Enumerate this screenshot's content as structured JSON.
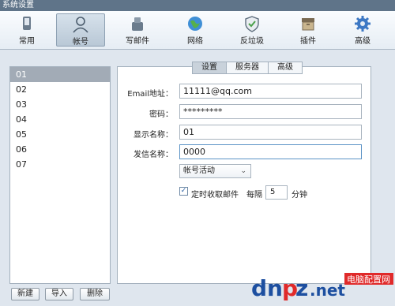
{
  "window": {
    "title": "系统设置"
  },
  "toolbar": {
    "items": [
      {
        "label": "常用",
        "icon": "phone-icon"
      },
      {
        "label": "帐号",
        "icon": "user-icon",
        "active": true
      },
      {
        "label": "写邮件",
        "icon": "compose-icon"
      },
      {
        "label": "网络",
        "icon": "globe-icon"
      },
      {
        "label": "反垃圾",
        "icon": "shield-icon"
      },
      {
        "label": "插件",
        "icon": "box-icon"
      },
      {
        "label": "高级",
        "icon": "gear-icon"
      }
    ]
  },
  "accounts": {
    "items": [
      "01",
      "02",
      "03",
      "04",
      "05",
      "06",
      "07"
    ],
    "selected": "01",
    "buttons": {
      "new": "新建",
      "import": "导入",
      "delete": "删除"
    }
  },
  "tabs": {
    "settings": "设置",
    "server": "服务器",
    "advanced": "高级",
    "active": "设置"
  },
  "form": {
    "email": {
      "label": "Email地址：",
      "value": "11111@qq.com"
    },
    "password": {
      "label": "密码：",
      "value": "*********"
    },
    "display_name": {
      "label": "显示名称：",
      "value": "01"
    },
    "sender_name": {
      "label": "发信名称：",
      "value": "0000"
    },
    "account_status": "帐号活动",
    "auto_receive": {
      "label": "定时收取邮件",
      "checked": true,
      "every": "每隔",
      "interval": "5",
      "unit": "分钟"
    }
  },
  "watermark": {
    "logo": "dnpz.net",
    "cn": "电脑配置网"
  },
  "colors": {
    "accent": "#5f7489",
    "selected_row": "#a2abb6",
    "watermark_red": "#e02a2a",
    "watermark_blue": "#1d4fa0"
  }
}
